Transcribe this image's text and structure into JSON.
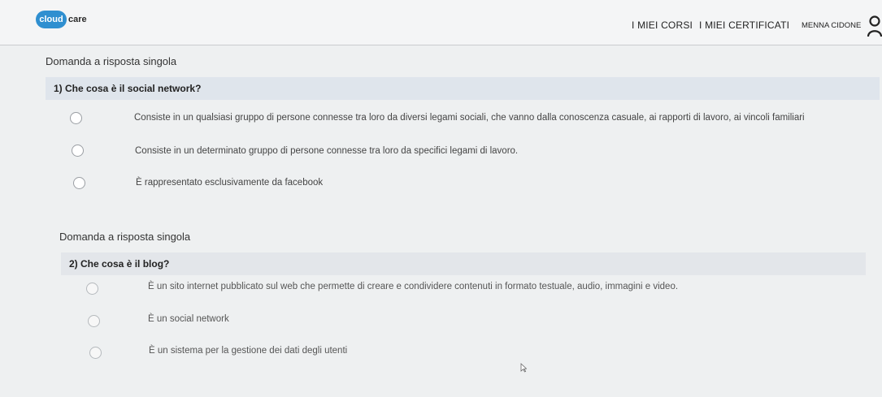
{
  "header": {
    "logo_cloud": "cloud",
    "logo_care": "care",
    "nav_courses": "I MIEI CORSI",
    "nav_certificates": "I MIEI CERTIFICATI",
    "user_name": "MENNA CIDONE",
    "user_icon": "user-icon"
  },
  "questions": [
    {
      "type_label": "Domanda a risposta singola",
      "title": "1) Che cosa è il social network?",
      "options": [
        "Consiste in un qualsiasi gruppo di persone connesse tra loro da diversi legami sociali, che vanno dalla conoscenza casuale, ai rapporti di lavoro, ai vincoli familiari",
        "Consiste in un determinato gruppo di persone connesse tra loro da specifici legami di lavoro.",
        "È rappresentato esclusivamente da facebook"
      ]
    },
    {
      "type_label": "Domanda a risposta singola",
      "title": "2) Che cosa è il blog?",
      "options": [
        "È un sito internet pubblicato sul web che permette di creare e condividere contenuti in formato testuale, audio, immagini e video.",
        "È un social network",
        "È un sistema per la gestione dei dati degli utenti"
      ]
    }
  ],
  "colors": {
    "accent": "#2f8fd0",
    "question_bar": "#dfe5ec",
    "background": "#eef0f1"
  }
}
